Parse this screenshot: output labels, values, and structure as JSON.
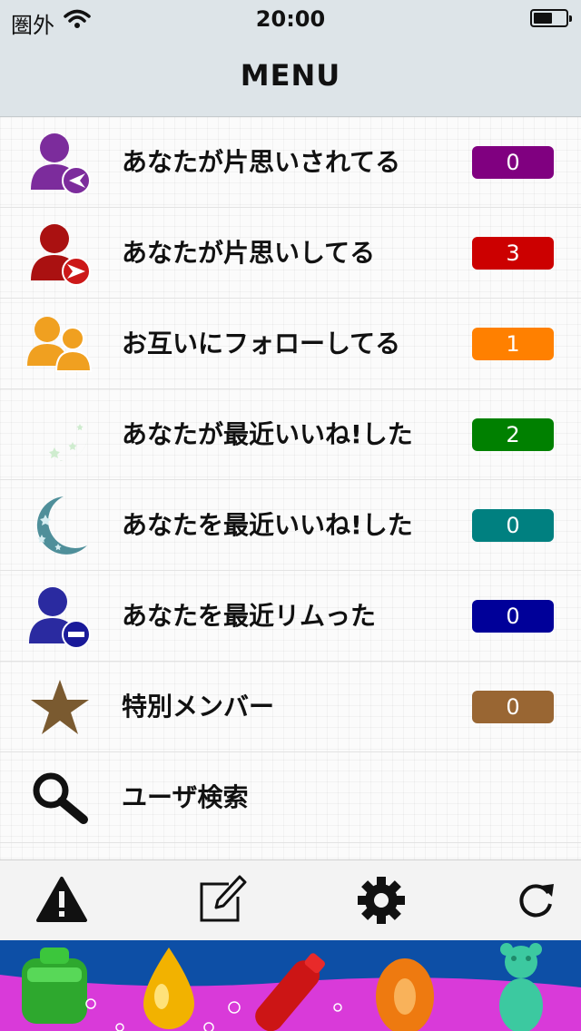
{
  "status_bar": {
    "carrier": "圏外",
    "time": "20:00"
  },
  "nav": {
    "title": "MENU"
  },
  "menu": [
    {
      "label": "あなたが片思いされてる",
      "count": "0",
      "color": "#800080",
      "icon": "person-arrow-in-icon"
    },
    {
      "label": "あなたが片思いしてる",
      "count": "3",
      "color": "#cc0000",
      "icon": "person-arrow-out-icon"
    },
    {
      "label": "お互いにフォローしてる",
      "count": "1",
      "color": "#ff8000",
      "icon": "two-people-icon"
    },
    {
      "label": "あなたが最近いいね!した",
      "count": "2",
      "color": "#008000",
      "icon": "green-crescent-moon-icon"
    },
    {
      "label": "あなたを最近いいね!した",
      "count": "0",
      "color": "#008080",
      "icon": "teal-crescent-moon-icon"
    },
    {
      "label": "あなたを最近リムった",
      "count": "0",
      "color": "#000099",
      "icon": "person-minus-icon"
    },
    {
      "label": "特別メンバー",
      "count": "0",
      "color": "#996633",
      "icon": "star-icon"
    },
    {
      "label": "ユーザ検索",
      "icon": "magnifier-icon"
    }
  ],
  "toolbar": {
    "items": [
      "warning-icon",
      "compose-icon",
      "gear-icon",
      "refresh-icon"
    ]
  },
  "ad": {
    "theme": "candy-banner"
  }
}
